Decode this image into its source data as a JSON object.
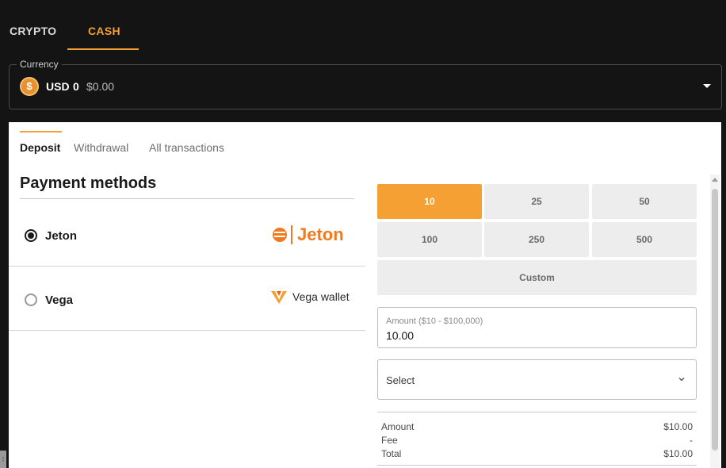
{
  "top_tabs": {
    "crypto": "CRYPTO",
    "cash": "CASH"
  },
  "currency": {
    "legend": "Currency",
    "coin_symbol": "$",
    "code": "USD",
    "balance": "0",
    "balance_usd": "$0.00"
  },
  "sub_tabs": {
    "deposit": "Deposit",
    "withdrawal": "Withdrawal",
    "all": "All transactions"
  },
  "payment_methods": {
    "title": "Payment methods",
    "items": [
      {
        "name": "Jeton",
        "logo_text": "Jeton",
        "selected": true
      },
      {
        "name": "Vega",
        "logo_text": "Vega wallet",
        "selected": false
      }
    ]
  },
  "amounts": {
    "options": [
      "10",
      "25",
      "50",
      "100",
      "250",
      "500"
    ],
    "custom_label": "Custom",
    "selected": "10"
  },
  "amount_field": {
    "label": "Amount ($10 - $100,000)",
    "value": "10.00"
  },
  "select_field": {
    "label": "Select"
  },
  "summary": {
    "amount_label": "Amount",
    "amount_value": "$10.00",
    "fee_label": "Fee",
    "fee_value": "-",
    "total_label": "Total",
    "total_value": "$10.00"
  },
  "colors": {
    "accent": "#f5a033",
    "background": "#141414",
    "panel": "#ffffff",
    "jeton": "#f07a1e"
  }
}
